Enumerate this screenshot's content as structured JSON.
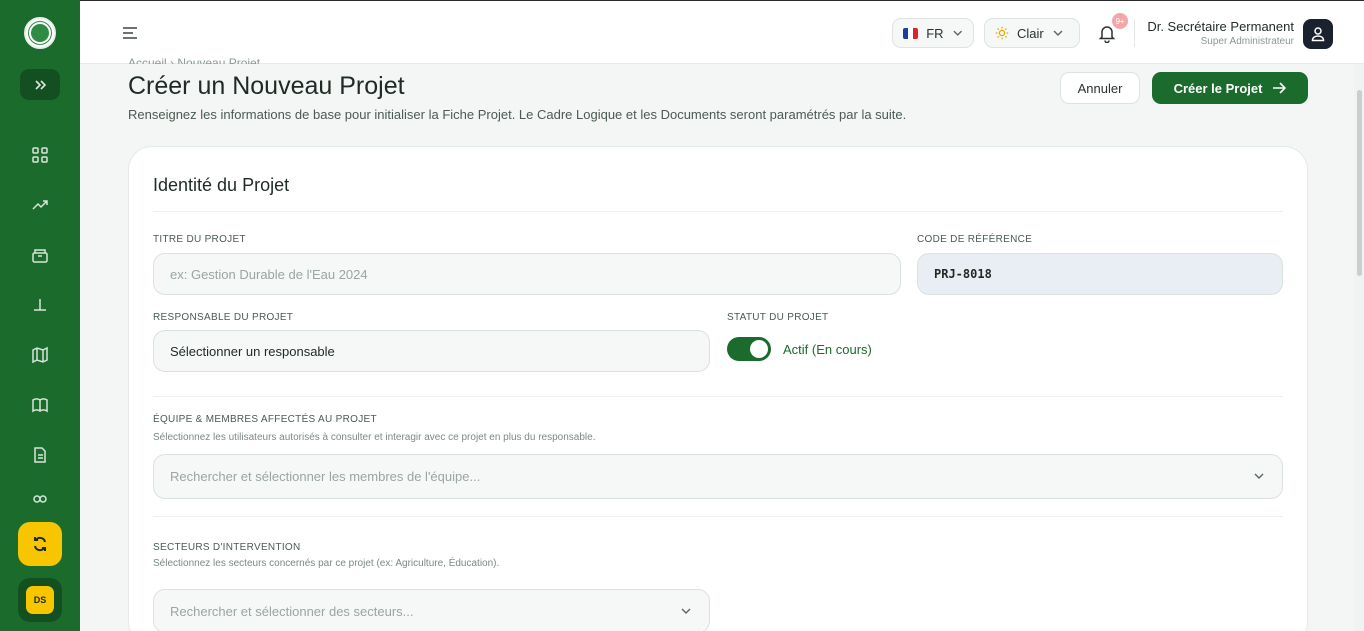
{
  "sidebar": {
    "expand_icon": "double-chevron-right-icon",
    "nav_icons": [
      "grid-icon",
      "trending-up-icon",
      "archive-icon",
      "plant-icon",
      "map-icon",
      "book-icon",
      "document-icon",
      "users-icon"
    ],
    "refresh_icon": "refresh-icon",
    "avatar_initials": "DS"
  },
  "topbar": {
    "language": "FR",
    "theme": "Clair",
    "notifications_badge": "9+",
    "user_name": "Dr. Secrétaire Permanent",
    "user_role": "Super Administrateur"
  },
  "page": {
    "breadcrumb": "Accueil › Nouveau Projet",
    "title": "Créer un Nouveau Projet",
    "subtitle": "Renseignez les informations de base pour initialiser la Fiche Projet. Le Cadre Logique et les Documents seront paramétrés par la suite.",
    "cancel_label": "Annuler",
    "create_label": "Créer le Projet"
  },
  "form": {
    "section_title": "Identité du Projet",
    "title_label": "TITRE DU PROJET",
    "title_placeholder": "ex: Gestion Durable de l'Eau 2024",
    "code_label": "CODE DE RÉFÉRENCE",
    "code_value": "PRJ-8018",
    "manager_label": "RESPONSABLE DU PROJET",
    "manager_value": "Sélectionner un responsable",
    "status_label": "STATUT DU PROJET",
    "status_value": "Actif (En cours)",
    "status_on": true,
    "team_label": "ÉQUIPE & MEMBRES AFFECTÉS AU PROJET",
    "team_hint": "Sélectionnez les utilisateurs autorisés à consulter et interagir avec ce projet en plus du responsable.",
    "team_placeholder": "Rechercher et sélectionner les membres de l'équipe...",
    "sectors_label": "SECTEURS D'INTERVENTION",
    "sectors_hint": "Sélectionnez les secteurs concernés par ce projet (ex: Agriculture, Éducation).",
    "sectors_placeholder": "Rechercher et sélectionner des secteurs..."
  },
  "colors": {
    "primary": "#1b6b2c",
    "accent": "#f7c600",
    "background": "#f3f6f4"
  }
}
